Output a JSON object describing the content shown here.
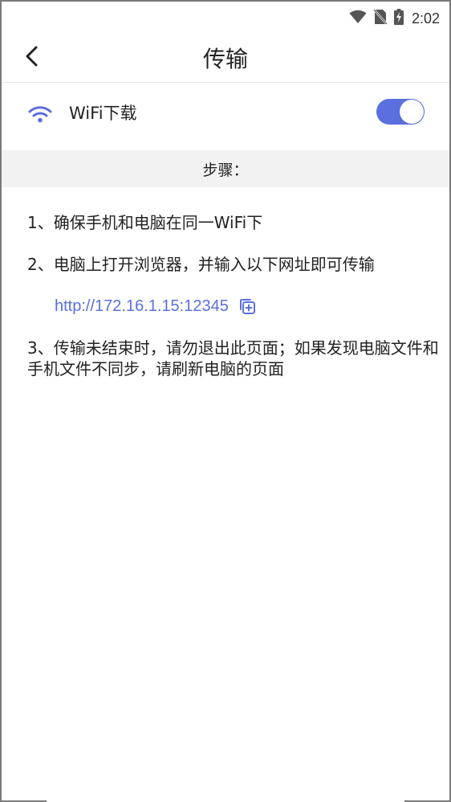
{
  "status_bar": {
    "time": "2:02",
    "icons": [
      "wifi-signal-icon",
      "no-sim-icon",
      "battery-charging-icon"
    ]
  },
  "title_bar": {
    "title": "传输",
    "back_icon": "chevron-left-icon"
  },
  "wifi_row": {
    "icon": "wifi-icon",
    "label": "WiFi下载",
    "toggle_on": true
  },
  "steps": {
    "header": "步骤：",
    "items": [
      "1、确保手机和电脑在同一WiFi下",
      "2、电脑上打开浏览器，并输入以下网址即可传输",
      "3、传输未结束时，请勿退出此页面；如果发现电脑文件和手机文件不同步，请刷新电脑的页面"
    ],
    "url": "http://172.16.1.15:12345",
    "copy_icon": "copy-icon"
  },
  "colors": {
    "accent": "#5b6fdf",
    "section_bg": "#f2f2f2",
    "text": "#222222"
  }
}
